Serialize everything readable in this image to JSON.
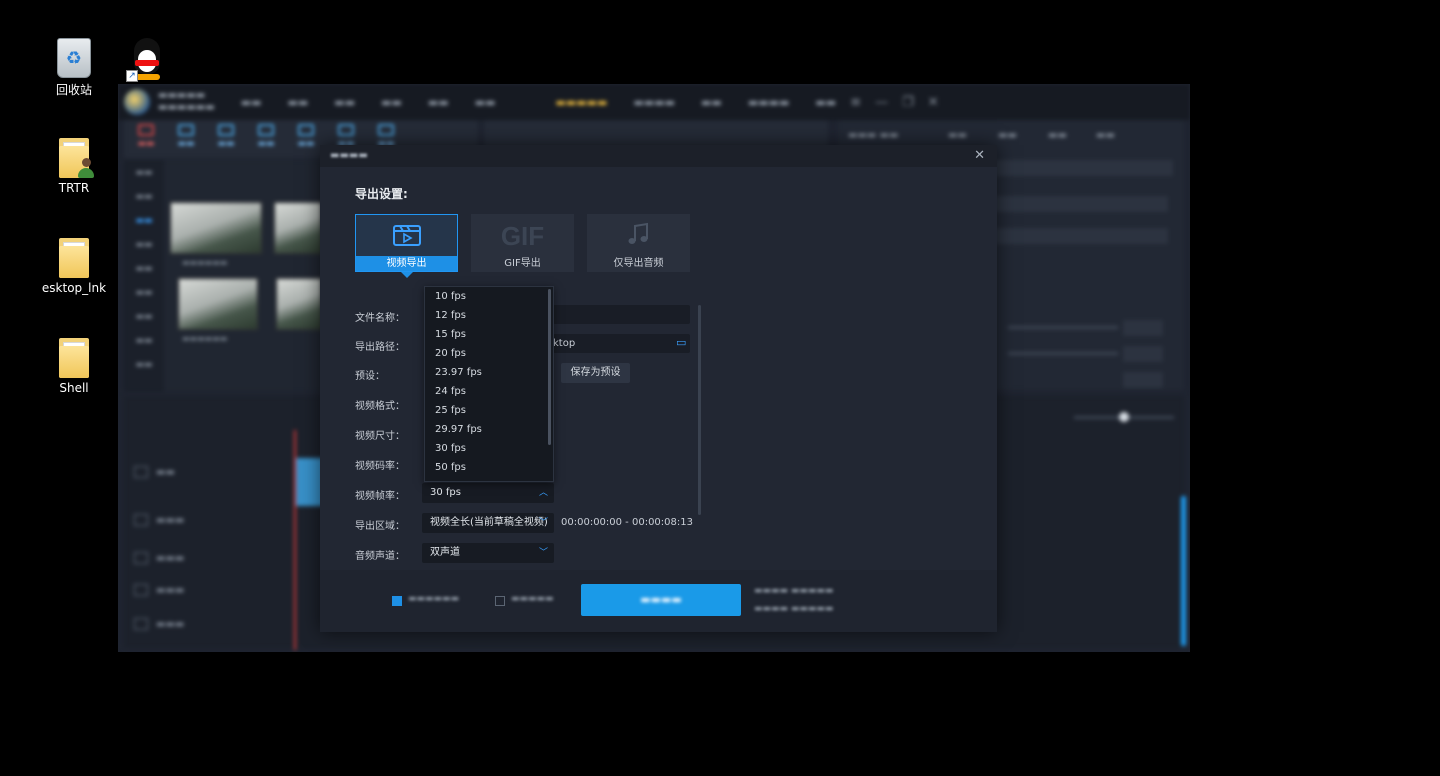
{
  "desktop": {
    "icons": [
      {
        "label": "回收站",
        "icon": "recycle-bin-icon"
      },
      {
        "label": "TRTR",
        "icon": "user-folder-icon"
      },
      {
        "label": "esktop_lnk",
        "icon": "folder-icon"
      },
      {
        "label": "Shell",
        "icon": "folder-icon"
      }
    ],
    "extra_icon": "qq-penguin-icon"
  },
  "dialog": {
    "settings_heading": "导出设置:",
    "modes": [
      {
        "label": "视频导出",
        "icon": "video-export-icon",
        "active": true
      },
      {
        "label": "GIF导出",
        "icon_text": "GIF",
        "active": false
      },
      {
        "label": "仅导出音频",
        "icon": "music-note-icon",
        "active": false
      }
    ],
    "fields": {
      "filename_label": "文件名称：",
      "path_label": "导出路径：",
      "path_value": "ktop",
      "preset_label": "预设：",
      "save_preset_button": "保存为预设",
      "format_label": "视频格式：",
      "size_label": "视频尺寸：",
      "bitrate_label": "视频码率：",
      "framerate_label": "视频帧率：",
      "framerate_value": "30 fps",
      "range_label": "导出区域：",
      "range_value": "视频全长(当前草稿全视频)",
      "range_time": "00:00:00:00 - 00:00:08:13",
      "audio_label": "音频声道：",
      "audio_value": "双声道"
    },
    "fps_options": [
      "10 fps",
      "12 fps",
      "15 fps",
      "20 fps",
      "23.97 fps",
      "24 fps",
      "25 fps",
      "29.97 fps",
      "30 fps",
      "50 fps"
    ]
  },
  "colors": {
    "accent": "#1e90e6",
    "dialog_bg": "#222733",
    "dropdown_bg": "#151920"
  }
}
